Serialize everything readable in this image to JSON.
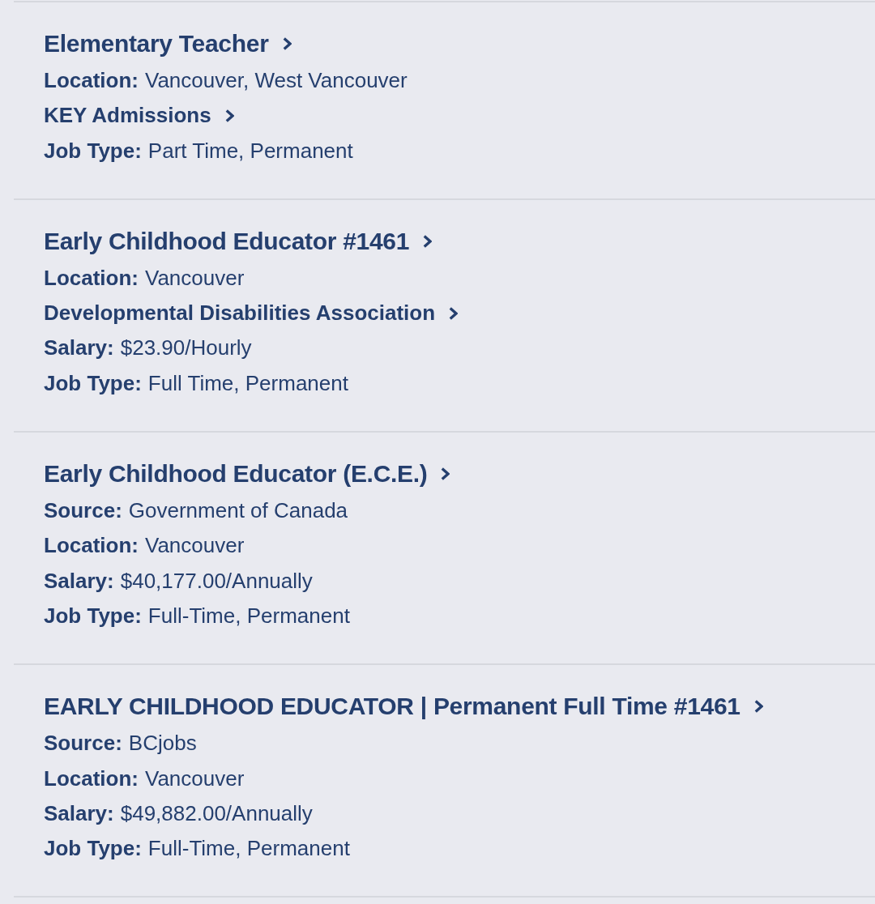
{
  "jobs": [
    {
      "title": "Elementary Teacher",
      "details": [
        {
          "kind": "field",
          "label": "Location:",
          "value": "Vancouver, West Vancouver"
        },
        {
          "kind": "link",
          "text": "KEY Admissions"
        },
        {
          "kind": "field",
          "label": "Job Type:",
          "value": "Part Time, Permanent"
        }
      ]
    },
    {
      "title": "Early Childhood Educator #1461",
      "details": [
        {
          "kind": "field",
          "label": "Location:",
          "value": "Vancouver"
        },
        {
          "kind": "link",
          "text": "Developmental Disabilities Association"
        },
        {
          "kind": "field",
          "label": "Salary:",
          "value": "$23.90/Hourly"
        },
        {
          "kind": "field",
          "label": "Job Type:",
          "value": "Full Time, Permanent"
        }
      ]
    },
    {
      "title": "Early Childhood Educator (E.C.E.)",
      "details": [
        {
          "kind": "field",
          "label": "Source:",
          "value": "Government of Canada"
        },
        {
          "kind": "field",
          "label": "Location:",
          "value": "Vancouver"
        },
        {
          "kind": "field",
          "label": "Salary:",
          "value": "$40,177.00/Annually"
        },
        {
          "kind": "field",
          "label": "Job Type:",
          "value": "Full-Time, Permanent"
        }
      ]
    },
    {
      "title": "EARLY CHILDHOOD EDUCATOR | Permanent Full Time #1461",
      "details": [
        {
          "kind": "field",
          "label": "Source:",
          "value": "BCjobs"
        },
        {
          "kind": "field",
          "label": "Location:",
          "value": "Vancouver"
        },
        {
          "kind": "field",
          "label": "Salary:",
          "value": "$49,882.00/Annually"
        },
        {
          "kind": "field",
          "label": "Job Type:",
          "value": "Full-Time, Permanent"
        }
      ]
    }
  ]
}
